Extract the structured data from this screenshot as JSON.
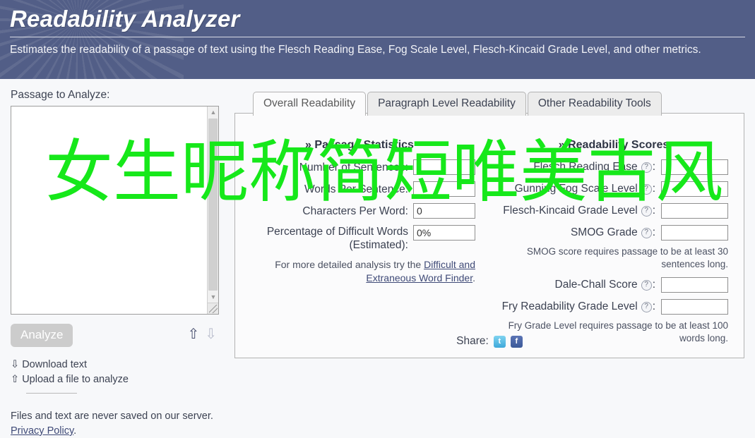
{
  "header": {
    "title": "Readability Analyzer",
    "subtitle": "Estimates the readability of a passage of text using the Flesch Reading Ease, Fog Scale Level, Flesch-Kincaid Grade Level, and other metrics.",
    "background_color": "#525e87"
  },
  "left": {
    "passage_label": "Passage to Analyze:",
    "passage_value": "",
    "passage_placeholder": "",
    "analyze_label": "Analyze",
    "scroll_up_glyph": "▲",
    "scroll_down_glyph": "▼",
    "arrow_up_glyph": "⇧",
    "arrow_down_glyph": "⇩",
    "download_glyph": "⇩",
    "download_label": "Download text",
    "upload_glyph": "⇧",
    "upload_label": "Upload a file to analyze",
    "privacy_note": "Files and text are never saved on our server.",
    "privacy_link": "Privacy Policy",
    "privacy_period": "."
  },
  "tabs": [
    {
      "label": "Overall Readability",
      "active": true
    },
    {
      "label": "Paragraph Level Readability",
      "active": false
    },
    {
      "label": "Other Readability Tools",
      "active": false
    }
  ],
  "passage_statistics": {
    "heading_chevron": "»",
    "heading": "Passage Statistics",
    "rows": [
      {
        "label": "Number of Sentences:",
        "value": ""
      },
      {
        "label": "Words Per Sentence:",
        "value": ""
      },
      {
        "label": "Characters Per Word:",
        "value": "0"
      },
      {
        "label": "Percentage of Difficult Words (Estimated):",
        "value": "0%"
      }
    ],
    "note_prefix": "For more detailed analysis try the ",
    "note_link": "Difficult and Extraneous Word Finder",
    "note_suffix": "."
  },
  "readability_scores": {
    "heading_chevron": "»",
    "heading": "Readability Scores",
    "help_glyph": "?",
    "rows": [
      {
        "label": "Flesch Reading Ease",
        "value": "",
        "note": ""
      },
      {
        "label": "Gunning Fog Scale Level",
        "value": "",
        "note": ""
      },
      {
        "label": "Flesch-Kincaid Grade Level",
        "value": "",
        "note": ""
      },
      {
        "label": "SMOG Grade",
        "value": "",
        "note": "SMOG score requires passage to be at least 30 sentences long."
      },
      {
        "label": "Dale-Chall Score",
        "value": "",
        "note": ""
      },
      {
        "label": "Fry Readability Grade Level",
        "value": "",
        "note": "Fry Grade Level requires passage to be at least 100 words long."
      }
    ]
  },
  "share": {
    "label": "Share:",
    "twitter_icon": "t",
    "facebook_icon": "f"
  },
  "overlay": {
    "text": "女生昵称简短唯美古风",
    "color": "#16e81a"
  }
}
